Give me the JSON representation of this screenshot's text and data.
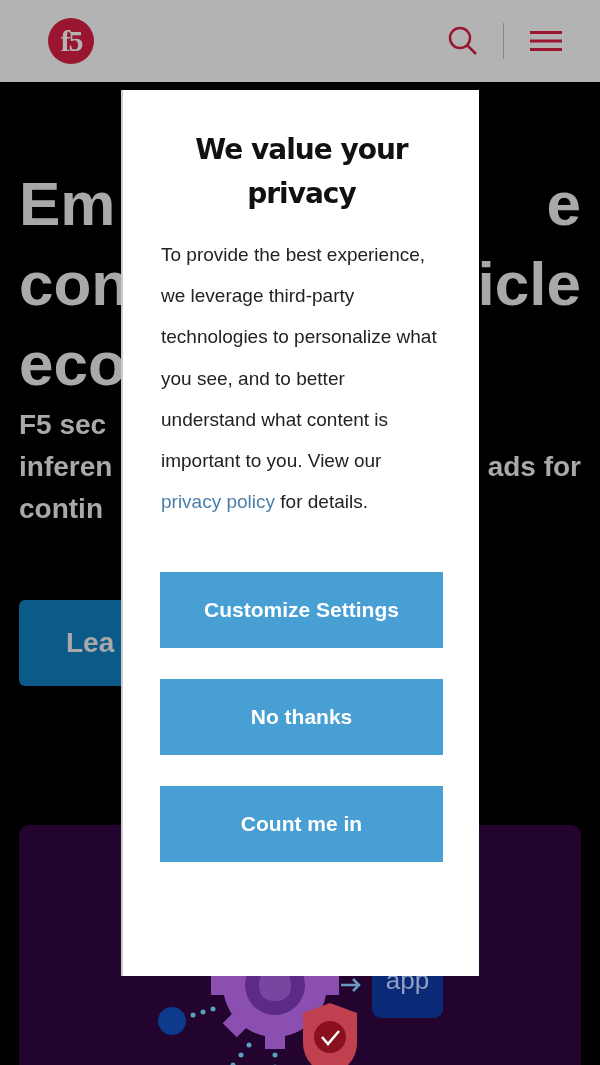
{
  "header": {
    "logo": "f5"
  },
  "hero": {
    "headline": [
      {
        "left": "Em",
        "right": "e"
      },
      {
        "left": "con",
        "right": "icle"
      },
      {
        "left": "eco"
      }
    ],
    "subtitle": [
      {
        "left": "F5 sec"
      },
      {
        "left": "inferen",
        "right": "ads for"
      },
      {
        "left": "contin"
      }
    ],
    "button": "Lea"
  },
  "card": {
    "tile": "app"
  },
  "modal": {
    "title": "We value your privacy",
    "body": "To provide the best experience, we leverage third-party technologies to personalize what you see, and to better understand what content is important to you. View our ",
    "link": "privacy policy",
    "body_end": " for details.",
    "buttons": [
      "Customize Settings",
      "No thanks",
      "Count me in"
    ]
  }
}
